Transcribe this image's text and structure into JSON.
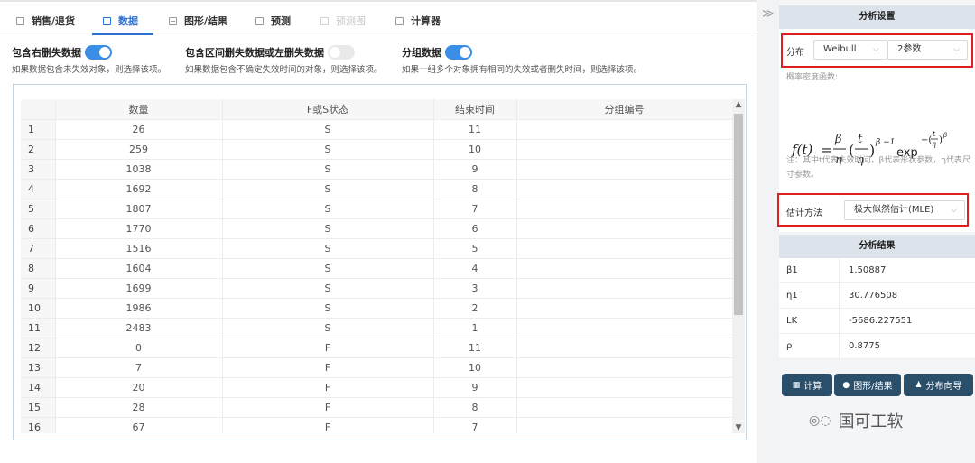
{
  "tabs": [
    {
      "label": "销售/退货",
      "icon": "grid-icon"
    },
    {
      "label": "数据",
      "icon": "grid-icon"
    },
    {
      "label": "图形/结果",
      "icon": "chart-icon"
    },
    {
      "label": "预测",
      "icon": "grid-icon"
    },
    {
      "label": "预测图",
      "icon": "grid-icon"
    },
    {
      "label": "计算器",
      "icon": "grid-icon"
    }
  ],
  "options": [
    {
      "title": "包含右删失数据",
      "desc": "如果数据包含未失效对象，则选择该项。",
      "on": true
    },
    {
      "title": "包含区间删失数据或左删失数据",
      "desc": "如果数据包含不确定失效时间的对象，则选择该项。",
      "on": false
    },
    {
      "title": "分组数据",
      "desc": "如果一组多个对象拥有相同的失效或者删失时间，则选择该项。",
      "on": true
    }
  ],
  "table": {
    "headers": [
      "",
      "数量",
      "F或S状态",
      "结束时间",
      "分组编号"
    ],
    "rows": [
      [
        "1",
        "26",
        "S",
        "11",
        ""
      ],
      [
        "2",
        "259",
        "S",
        "10",
        ""
      ],
      [
        "3",
        "1038",
        "S",
        "9",
        ""
      ],
      [
        "4",
        "1692",
        "S",
        "8",
        ""
      ],
      [
        "5",
        "1807",
        "S",
        "7",
        ""
      ],
      [
        "6",
        "1770",
        "S",
        "6",
        ""
      ],
      [
        "7",
        "1516",
        "S",
        "5",
        ""
      ],
      [
        "8",
        "1604",
        "S",
        "4",
        ""
      ],
      [
        "9",
        "1699",
        "S",
        "3",
        ""
      ],
      [
        "10",
        "1986",
        "S",
        "2",
        ""
      ],
      [
        "11",
        "2483",
        "S",
        "1",
        ""
      ],
      [
        "12",
        "0",
        "F",
        "11",
        ""
      ],
      [
        "13",
        "7",
        "F",
        "10",
        ""
      ],
      [
        "14",
        "20",
        "F",
        "9",
        ""
      ],
      [
        "15",
        "28",
        "F",
        "8",
        ""
      ],
      [
        "16",
        "67",
        "F",
        "7",
        ""
      ]
    ]
  },
  "side": {
    "settings_title": "分析设置",
    "dist_label": "分布",
    "dist_value": "Weibull",
    "param_value": "2参数",
    "pdf_label": "概率密度函数:",
    "formula": {
      "lhs": "f(t)",
      "beta": "β",
      "eta": "η",
      "t": "t",
      "exp": "exp"
    },
    "note": "注：其中t代表失效时间，β代表形状参数，η代表尺寸参数。",
    "method_label": "估计方法",
    "method_value": "极大似然估计(MLE)",
    "results_title": "分析结果",
    "results": [
      {
        "key": "β1",
        "value": "1.50887"
      },
      {
        "key": "η1",
        "value": "30.776508"
      },
      {
        "key": "LK",
        "value": "-5686.227551"
      },
      {
        "key": "ρ",
        "value": "0.8775"
      }
    ],
    "buttons": [
      {
        "label": "计算",
        "icon": "calculator-icon"
      },
      {
        "label": "图形/结果",
        "icon": "chat-icon"
      },
      {
        "label": "分布向导",
        "icon": "wizard-icon"
      }
    ],
    "watermark": "国可工软"
  },
  "colors": {
    "accent": "#2f6fce",
    "toggle_on": "#3a8ee6",
    "button": "#2a4f6b",
    "highlight": "#e02020"
  }
}
